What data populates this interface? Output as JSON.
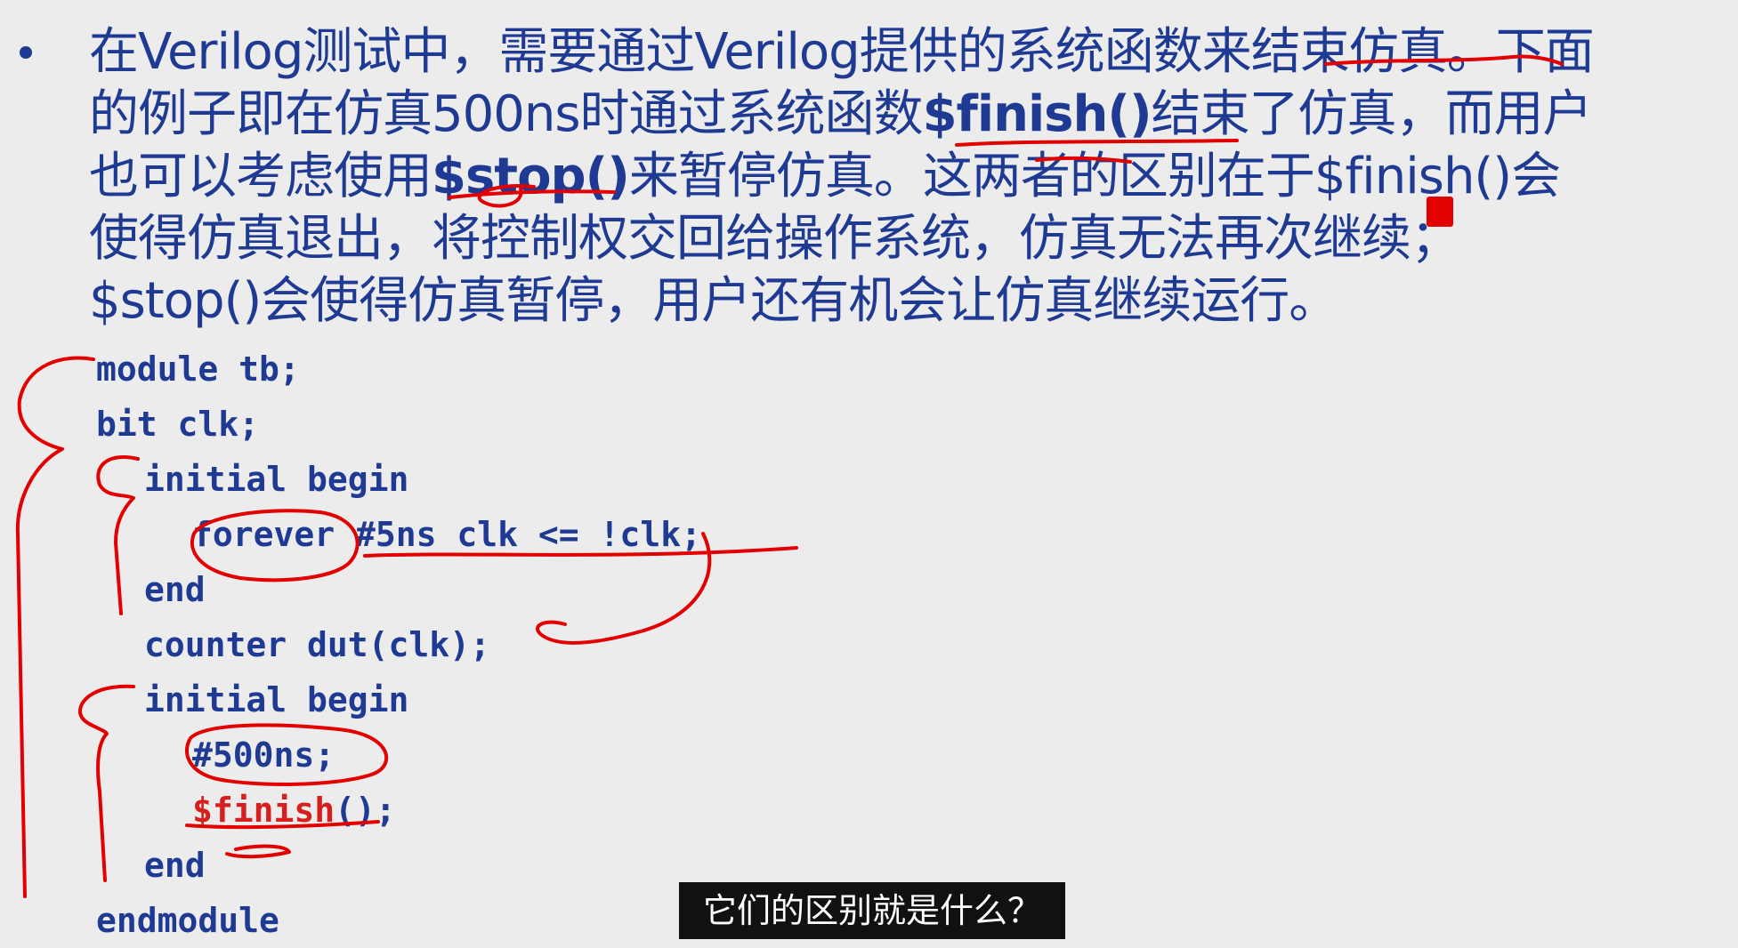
{
  "slide": {
    "paragraph": {
      "line1": "在Verilog测试中，需要通过Verilog提供的系统函数来结束仿真。下面",
      "line2_pre": "的例子即在仿真500ns时通过系统函数",
      "line2_bold": "$finish()",
      "line2_post": "结束了仿真，而用户",
      "line3_pre": "也可以考虑使用",
      "line3_bold": "$stop()",
      "line3_post": "来暂停仿真。这两者的区别在于$finish()会",
      "line4": "使得仿真退出，将控制权交回给操作系统，仿真无法再次继续；",
      "line5": "$stop()会使得仿真暂停，用户还有机会让仿真继续运行。"
    },
    "code": {
      "l1": "module tb;",
      "l2": "bit clk;",
      "l3": "initial begin",
      "l4": "forever #5ns clk <= !clk;",
      "l5": "end",
      "l6": "counter dut(clk);",
      "l7": "initial begin",
      "l8": "#500ns;",
      "l9": "$finish",
      "l9_tail": "();",
      "l10": "end",
      "l11": "endmodule"
    }
  },
  "subtitle": {
    "text": "它们的区别就是什么？"
  },
  "colors": {
    "text_blue": "#1f3a93",
    "ink_red": "#e20000",
    "background": "#ececec"
  }
}
